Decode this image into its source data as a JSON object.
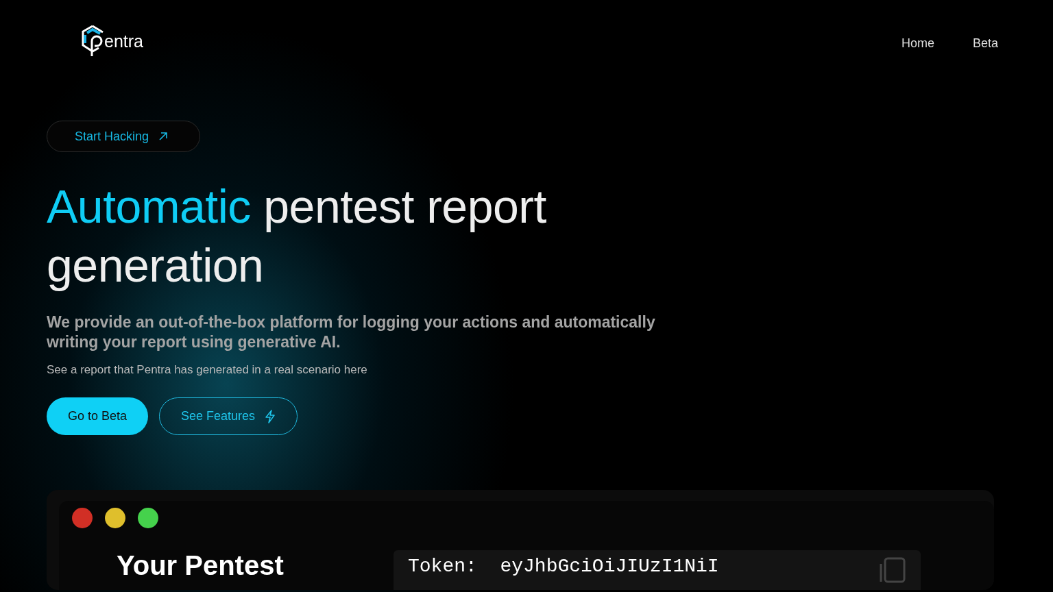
{
  "header": {
    "logo_text": "entra",
    "nav": [
      {
        "label": "Home"
      },
      {
        "label": "Beta"
      }
    ]
  },
  "hero": {
    "pill": "Start Hacking",
    "headline_accent": "Automatic",
    "headline_rest": "pentest report generation",
    "subtitle": "We provide an out-of-the-box platform for logging your actions and automatically writing your report using generative AI.",
    "note": "See a report that Pentra has generated in a real scenario here",
    "buttons": [
      {
        "label": "Go to Beta",
        "kind": "primary"
      },
      {
        "label": "See Features",
        "kind": "outline"
      }
    ]
  },
  "demo": {
    "dots": [
      {
        "color": "#d12f25"
      },
      {
        "color": "#dfbf2c"
      },
      {
        "color": "#45d24c"
      }
    ],
    "title": "Your Pentest",
    "token": "Token:  eyJhbGciOiJIUzI1NiI"
  }
}
